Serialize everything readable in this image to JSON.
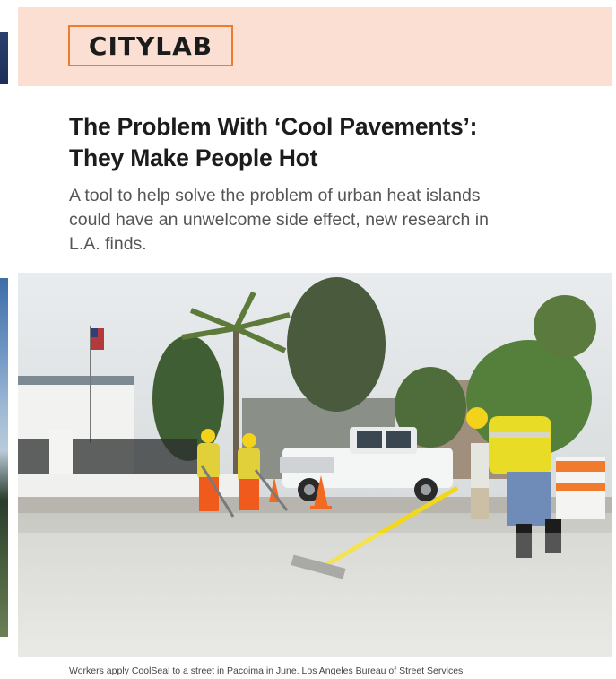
{
  "brand": {
    "logo_text": "CITYLAB",
    "accent_color": "#f07b2e",
    "masthead_color": "#fbdfd2"
  },
  "article": {
    "headline_line1": "The Problem With ‘Cool Pavements’:",
    "headline_line2": "They Make People Hot",
    "dek_line1": "A tool to help solve the problem of urban heat islands",
    "dek_line2": "could have an unwelcome side effect, new research in",
    "dek_line3": "L.A. finds."
  },
  "photo": {
    "caption": "Workers apply CoolSeal to a street in Pacoima in June. Los Angeles Bureau of Street Services"
  }
}
